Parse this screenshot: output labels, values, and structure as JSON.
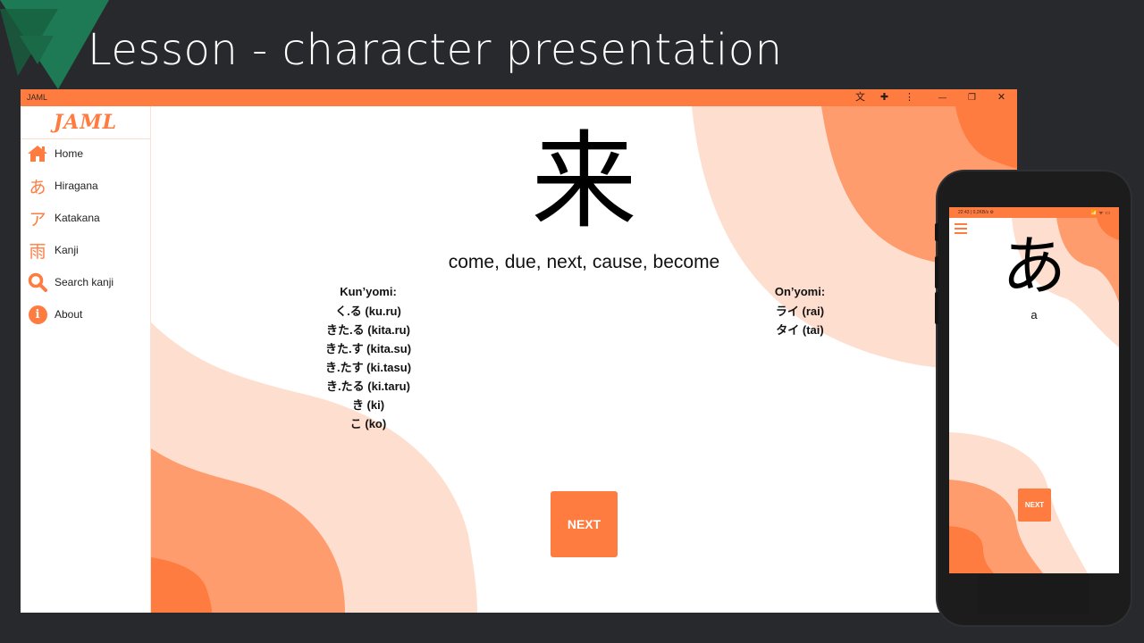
{
  "slide": {
    "title": "Lesson - character presentation",
    "colors": {
      "background": "#28292d",
      "deco_green": "#1e7a55",
      "deco_dark_green": "#17603f"
    }
  },
  "app": {
    "window_title": "JAML",
    "logo": "JAML",
    "titlebar_icons": [
      "translate-icon",
      "extensions-icon",
      "more-menu-icon",
      "minimize-icon",
      "maximize-icon",
      "close-icon"
    ],
    "titlebar_glyphs": {
      "translate": "文",
      "extensions": "✚",
      "more": "⋮",
      "minimize": "—",
      "maximize": "❐",
      "close": "✕"
    },
    "sidebar": {
      "items": [
        {
          "label": "Home",
          "icon": "home-icon",
          "glyph": ""
        },
        {
          "label": "Hiragana",
          "icon": "hiragana-icon",
          "glyph": "あ"
        },
        {
          "label": "Katakana",
          "icon": "katakana-icon",
          "glyph": "ア"
        },
        {
          "label": "Kanji",
          "icon": "kanji-icon",
          "glyph": "雨"
        },
        {
          "label": "Search kanji",
          "icon": "search-icon",
          "glyph": ""
        },
        {
          "label": "About",
          "icon": "info-icon",
          "glyph": "i"
        }
      ]
    },
    "lesson": {
      "character": "来",
      "meaning": "come, due, next, cause, become",
      "kunyomi": {
        "header": "Kun’yomi:",
        "readings": [
          "く.る (ku.ru)",
          "きた.る (kita.ru)",
          "きた.す (kita.su)",
          "き.たす (ki.tasu)",
          "き.たる (ki.taru)",
          "き (ki)",
          "こ (ko)"
        ]
      },
      "onyomi": {
        "header": "On’yomi:",
        "readings": [
          "ライ (rai)",
          "タイ (tai)"
        ]
      },
      "next_label": "NEXT"
    },
    "colors": {
      "accent": "#ff7c41",
      "wave_light": "#fedfcf",
      "wave_mid": "#ff9c6d",
      "wave_dark": "#ff7c41"
    }
  },
  "phone": {
    "status_left": "22:43 | 0,2KB/s ⚙",
    "status_right": "📶 ᯤ ▭",
    "character": "あ",
    "romaji": "a",
    "next_label": "NEXT"
  }
}
